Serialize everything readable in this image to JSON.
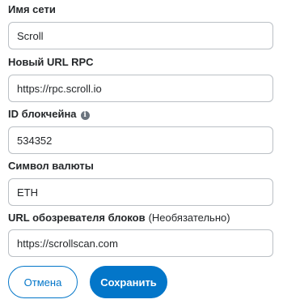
{
  "form": {
    "network_name": {
      "label": "Имя сети",
      "value": "Scroll"
    },
    "rpc_url": {
      "label": "Новый URL RPC",
      "value": "https://rpc.scroll.io"
    },
    "chain_id": {
      "label": "ID блокчейна",
      "value": "534352",
      "icon": "info-icon"
    },
    "currency_symbol": {
      "label": "Символ валюты",
      "value": "ETH"
    },
    "block_explorer": {
      "label": "URL обозревателя блоков",
      "optional_note": "(Необязательно)",
      "value": "https://scrollscan.com"
    }
  },
  "buttons": {
    "cancel": "Отмена",
    "save": "Сохранить"
  },
  "colors": {
    "accent": "#0376c9",
    "border": "#bbc0c5",
    "text": "#24272a"
  }
}
